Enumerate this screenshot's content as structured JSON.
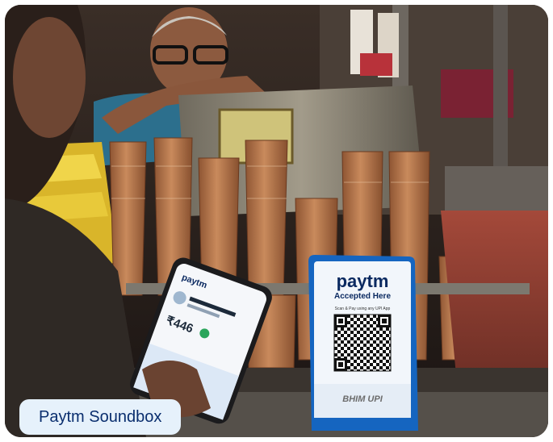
{
  "caption": "Paytm Soundbox",
  "soundbox": {
    "brand": "paytm",
    "subtitle": "Accepted Here",
    "note": "Scan & Pay using any UPI App",
    "footer_small": "",
    "footer": "BHIM UPI"
  },
  "phone": {
    "brand": "paytm",
    "amount": "₹446"
  },
  "colors": {
    "paytm_navy": "#0b2a61",
    "paytm_blue": "#00b9f1",
    "stand_blue": "#1565c0",
    "caption_bg": "#e6f1fb",
    "caption_text": "#0a2e6e",
    "clay": "#b8754a"
  }
}
